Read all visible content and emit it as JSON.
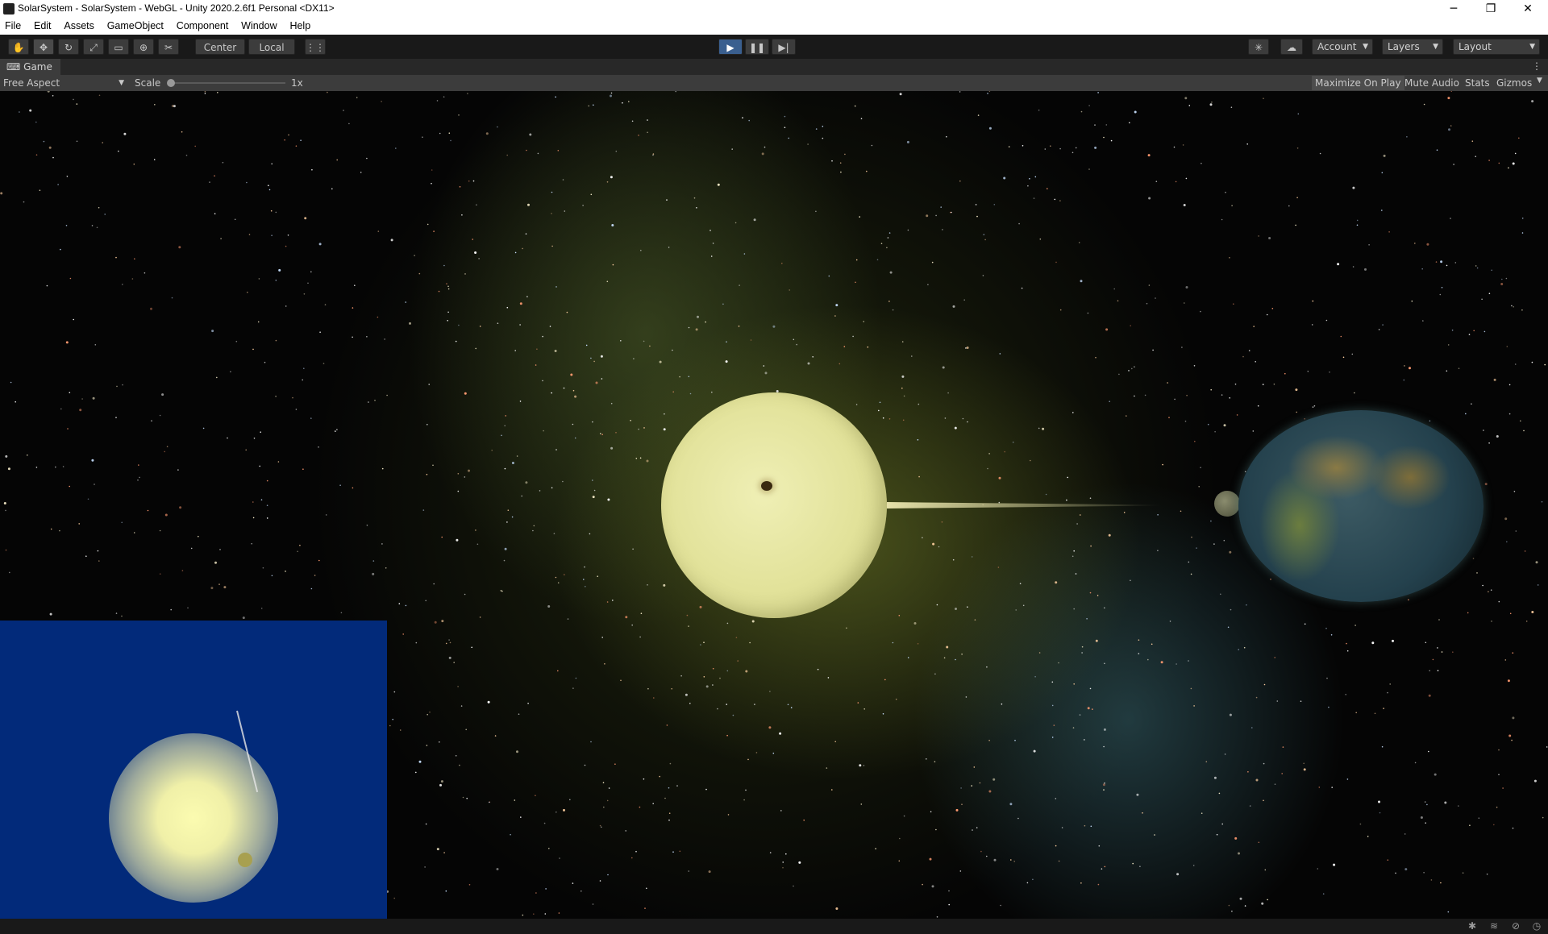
{
  "window": {
    "title": "SolarSystem - SolarSystem - WebGL - Unity 2020.2.6f1 Personal <DX11>",
    "minimize": "─",
    "restore": "❐",
    "close": "✕"
  },
  "menu": [
    "File",
    "Edit",
    "Assets",
    "GameObject",
    "Component",
    "Window",
    "Help"
  ],
  "toolbar": {
    "tools": [
      {
        "name": "hand-tool",
        "glyph": "✋"
      },
      {
        "name": "move-tool",
        "glyph": "✥"
      },
      {
        "name": "rotate-tool",
        "glyph": "↻"
      },
      {
        "name": "scale-tool",
        "glyph": "⤢"
      },
      {
        "name": "rect-tool",
        "glyph": "▭"
      },
      {
        "name": "transform-tool",
        "glyph": "⊕"
      },
      {
        "name": "custom-tool",
        "glyph": "✂"
      }
    ],
    "pivot_label": "Center",
    "space_label": "Local",
    "snap_glyph": "⋮⋮",
    "play_glyph": "▶",
    "pause_glyph": "❚❚",
    "step_glyph": "▶|",
    "collab_glyph": "✳",
    "cloud_glyph": "☁",
    "account_label": "Account",
    "layers_label": "Layers",
    "layout_label": "Layout"
  },
  "game": {
    "tab_label": "Game",
    "tab_menu": "⋮",
    "aspect_label": "Free Aspect",
    "scale_label": "Scale",
    "scale_value_label": "1x",
    "scale_value": 0.0,
    "maximize_label": "Maximize On Play",
    "mute_label": "Mute Audio",
    "stats_label": "Stats",
    "gizmos_label": "Gizmos"
  },
  "status": {
    "icons": [
      "bug-icon",
      "layers-icon",
      "network-icon",
      "clock-icon"
    ]
  },
  "colors": {
    "editor_bg": "#191919",
    "play_active": "#3a5f8f",
    "minimap_bg": "#022a7a"
  }
}
